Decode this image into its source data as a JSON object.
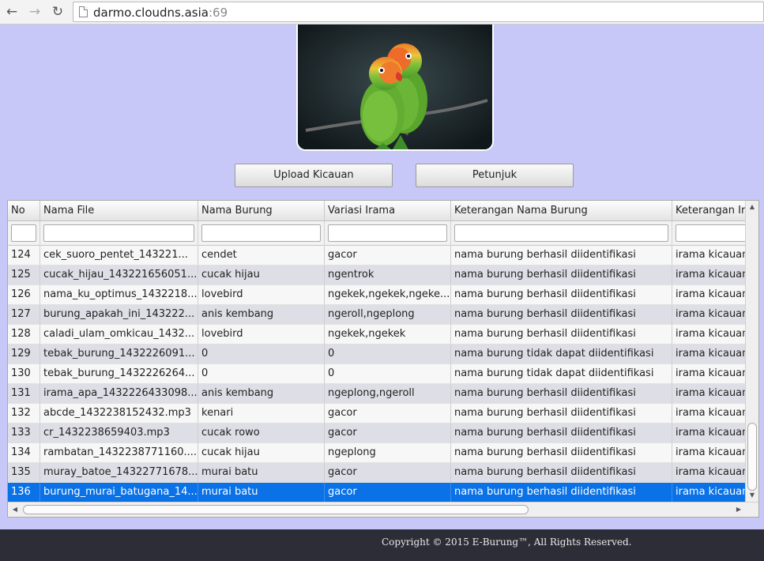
{
  "browser": {
    "url_host": "darmo.cloudns.asia",
    "url_port": ":69"
  },
  "buttons": {
    "upload": "Upload Kicauan",
    "help": "Petunjuk"
  },
  "table": {
    "columns": [
      "No",
      "Nama File",
      "Nama Burung",
      "Variasi Irama",
      "Keterangan Nama Burung",
      "Keterangan Irama"
    ],
    "header_visible": [
      "No",
      "Nama File",
      "Nama Burung",
      "Variasi Irama",
      "Keterangan Nama Burung",
      "Keterangan Ir"
    ],
    "rows": [
      [
        "124",
        "cek_suoro_pentet_143221...",
        "cendet",
        "gacor",
        "nama burung berhasil diidentifikasi",
        "irama kicauan"
      ],
      [
        "125",
        "cucak_hijau_143221656051...",
        "cucak hijau",
        "ngentrok",
        "nama burung berhasil diidentifikasi",
        "irama kicauan"
      ],
      [
        "126",
        "nama_ku_optimus_1432218...",
        "lovebird",
        "ngekek,ngekek,ngeke...",
        "nama burung berhasil diidentifikasi",
        "irama kicauan"
      ],
      [
        "127",
        "burung_apakah_ini_143222...",
        "anis kembang",
        "ngeroll,ngeplong",
        "nama burung berhasil diidentifikasi",
        "irama kicauan"
      ],
      [
        "128",
        "caladi_ulam_omkicau_1432...",
        "lovebird",
        "ngekek,ngekek",
        "nama burung berhasil diidentifikasi",
        "irama kicauan"
      ],
      [
        "129",
        "tebak_burung_1432226091...",
        "0",
        "0",
        "nama burung tidak dapat diidentifikasi",
        "irama kicauan"
      ],
      [
        "130",
        "tebak_burung_1432226264...",
        "0",
        "0",
        "nama burung tidak dapat diidentifikasi",
        "irama kicauan"
      ],
      [
        "131",
        "irama_apa_1432226433098...",
        "anis kembang",
        "ngeplong,ngeroll",
        "nama burung berhasil diidentifikasi",
        "irama kicauan"
      ],
      [
        "132",
        "abcde_1432238152432.mp3",
        "kenari",
        "gacor",
        "nama burung berhasil diidentifikasi",
        "irama kicauan"
      ],
      [
        "133",
        "cr_1432238659403.mp3",
        "cucak rowo",
        "gacor",
        "nama burung berhasil diidentifikasi",
        "irama kicauan"
      ],
      [
        "134",
        "rambatan_1432238771160....",
        "cucak hijau",
        "ngeplong",
        "nama burung berhasil diidentifikasi",
        "irama kicauan"
      ],
      [
        "135",
        "muray_batoe_14322771678...",
        "murai batu",
        "gacor",
        "nama burung berhasil diidentifikasi",
        "irama kicauan"
      ],
      [
        "136",
        "burung_murai_batugana_14...",
        "murai batu",
        "gacor",
        "nama burung berhasil diidentifikasi",
        "irama kicauan"
      ]
    ],
    "selected_row": "136"
  },
  "footer": {
    "copyright": "Copyright © 2015 E-Burung™, All Rights Reserved."
  },
  "colors": {
    "page_bg": "#c8c8f8",
    "selection": "#0a72e6",
    "footer_bg": "#2d2d37"
  },
  "icons": [
    "back-arrow-icon",
    "forward-arrow-icon",
    "reload-icon",
    "page-icon"
  ]
}
